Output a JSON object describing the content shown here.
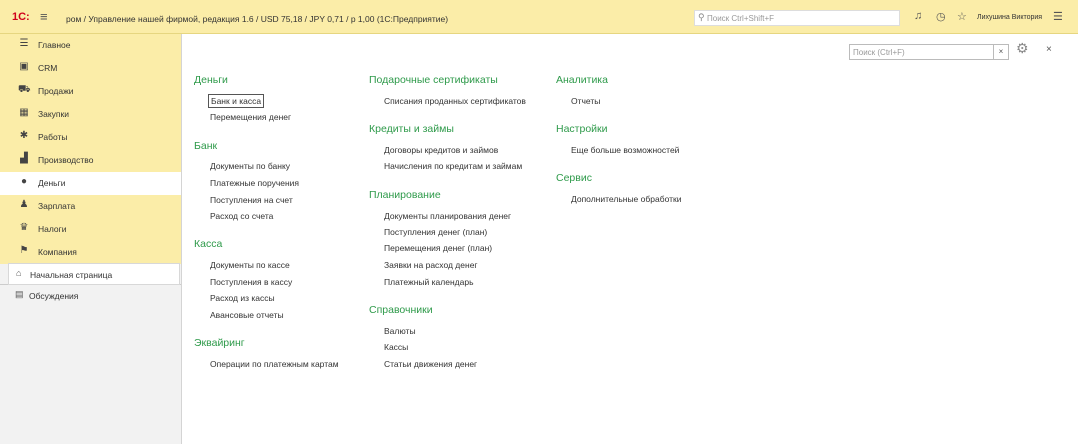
{
  "topbar": {
    "logo": "1С:",
    "title": "ром / Управление нашей фирмой, редакция 1.6 / USD 75,18 / JPY 0,71 / р 1,00  (1С:Предприятие)",
    "search_placeholder": "Поиск Ctrl+Shift+F",
    "user": "Лихушина Виктория"
  },
  "sidebar": {
    "items": [
      {
        "label": "Главное",
        "icon": "☰"
      },
      {
        "label": "CRM",
        "icon": "▣"
      },
      {
        "label": "Продажи",
        "icon": "⛟"
      },
      {
        "label": "Закупки",
        "icon": "▦"
      },
      {
        "label": "Работы",
        "icon": "✱"
      },
      {
        "label": "Производство",
        "icon": "▟"
      },
      {
        "label": "Деньги",
        "icon": "●"
      },
      {
        "label": "Зарплата",
        "icon": "♟"
      },
      {
        "label": "Налоги",
        "icon": "♛"
      },
      {
        "label": "Компания",
        "icon": "⚑"
      }
    ],
    "sub": [
      {
        "label": "Начальная страница",
        "icon": "⌂"
      },
      {
        "label": "Обсуждения",
        "icon": "▤"
      }
    ]
  },
  "main": {
    "search_placeholder": "Поиск (Ctrl+F)",
    "clear": "×",
    "close": "×",
    "columns": [
      {
        "sections": [
          {
            "title": "Деньги",
            "items": [
              "Банк и касса",
              "Перемещения денег"
            ]
          },
          {
            "title": "Банк",
            "items": [
              "Документы по банку",
              "Платежные поручения",
              "Поступления на счет",
              "Расход со счета"
            ]
          },
          {
            "title": "Касса",
            "items": [
              "Документы по кассе",
              "Поступления в кассу",
              "Расход из кассы",
              "Авансовые отчеты"
            ]
          },
          {
            "title": "Эквайринг",
            "items": [
              "Операции по платежным картам"
            ]
          }
        ]
      },
      {
        "sections": [
          {
            "title": "Подарочные сертификаты",
            "items": [
              "Списания проданных сертификатов"
            ]
          },
          {
            "title": "Кредиты и займы",
            "items": [
              "Договоры кредитов и займов",
              "Начисления по кредитам и займам"
            ]
          },
          {
            "title": "Планирование",
            "items": [
              "Документы планирования денег",
              "Поступления денег (план)",
              "Перемещения денег (план)",
              "Заявки на расход денег",
              "Платежный календарь"
            ]
          },
          {
            "title": "Справочники",
            "items": [
              "Валюты",
              "Кассы",
              "Статьи движения денег"
            ]
          }
        ]
      },
      {
        "sections": [
          {
            "title": "Аналитика",
            "items": [
              "Отчеты"
            ]
          },
          {
            "title": "Настройки",
            "items": [
              "Еще больше возможностей"
            ]
          },
          {
            "title": "Сервис",
            "items": [
              "Дополнительные обработки"
            ]
          }
        ]
      }
    ]
  }
}
